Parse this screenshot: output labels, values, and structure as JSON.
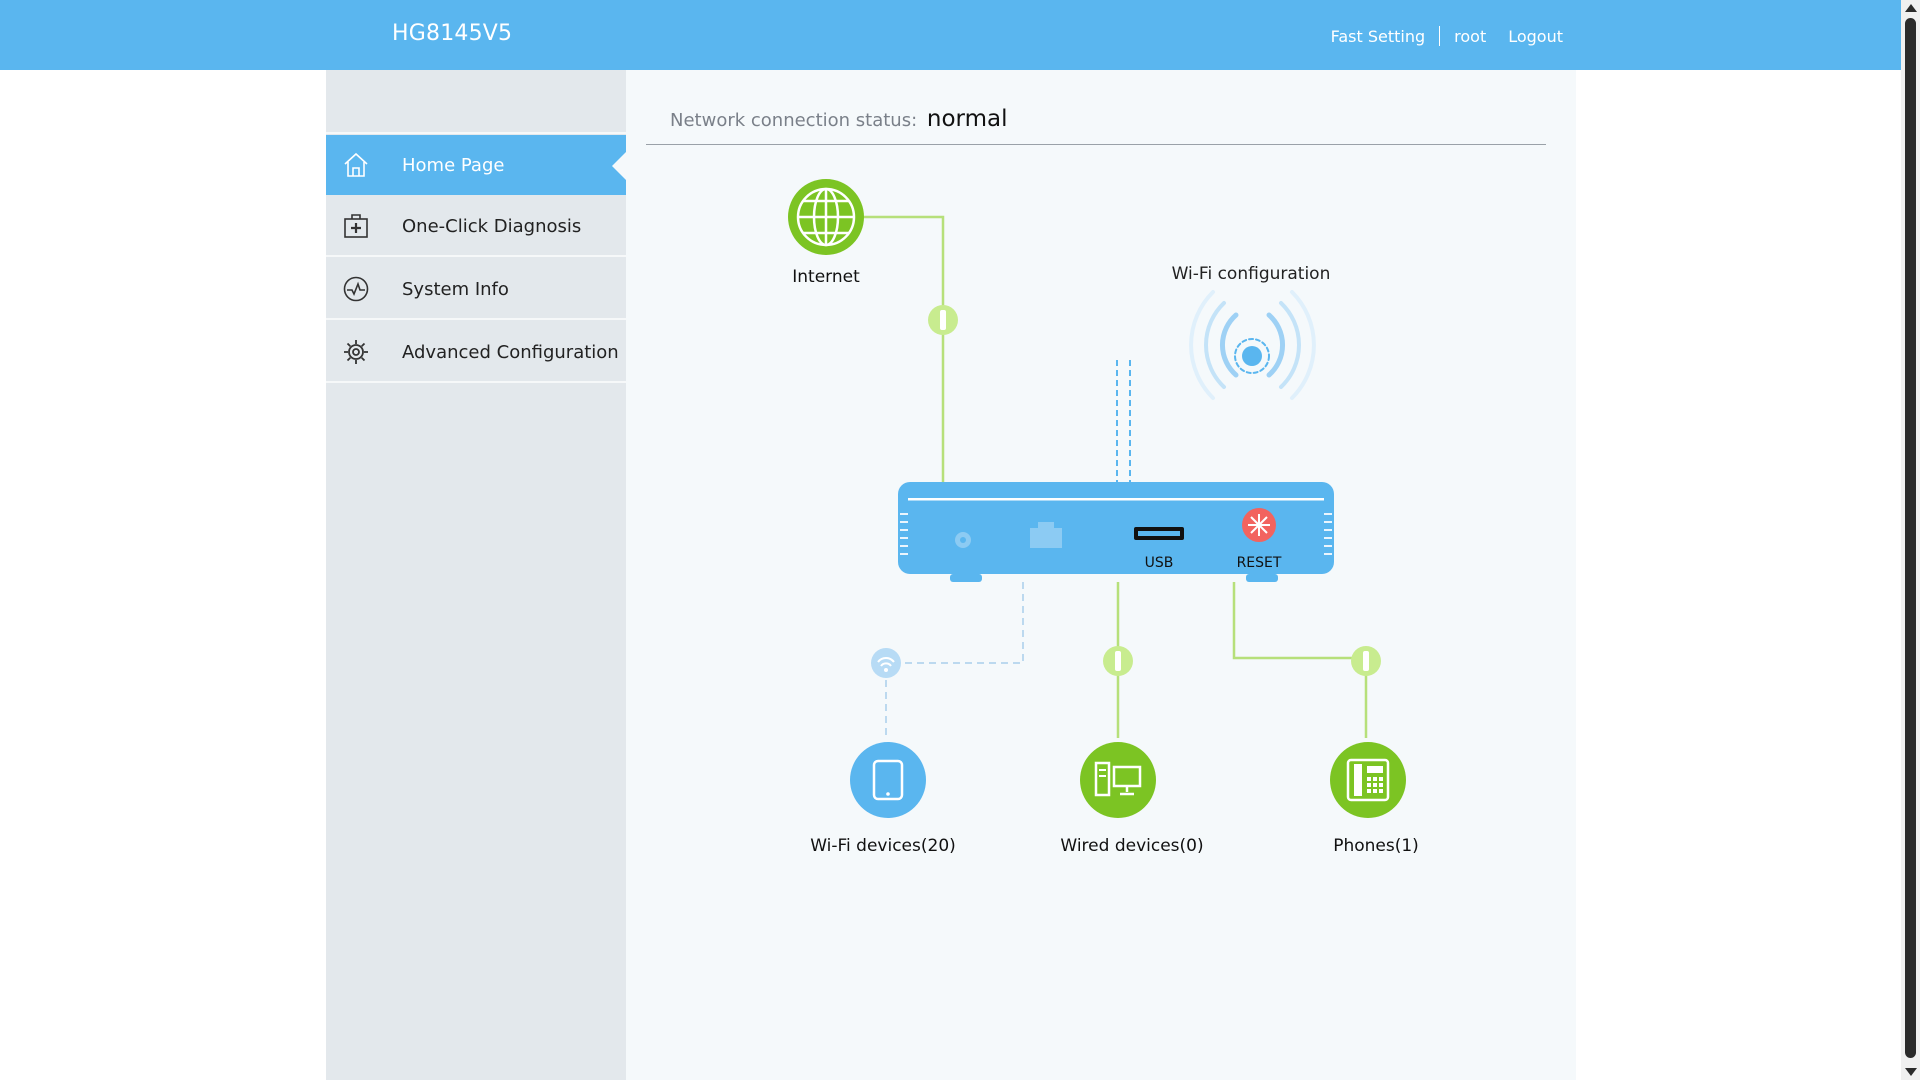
{
  "header": {
    "title": "HG8145V5",
    "links": {
      "fast_setting": "Fast Setting",
      "user": "root",
      "logout": "Logout"
    }
  },
  "sidebar": {
    "items": [
      {
        "label": "Home Page",
        "icon": "home-icon",
        "active": true
      },
      {
        "label": "One-Click Diagnosis",
        "icon": "first-aid-kit-icon",
        "active": false
      },
      {
        "label": "System Info",
        "icon": "pulse-icon",
        "active": false
      },
      {
        "label": "Advanced Configuration",
        "icon": "gear-icon",
        "active": false
      }
    ]
  },
  "main": {
    "status_label": "Network connection status:",
    "status_value": "normal",
    "diagram": {
      "internet_label": "Internet",
      "wifi_config_label": "Wi-Fi configuration",
      "usb_label": "USB",
      "reset_label": "RESET",
      "wifi_devices_label": "Wi-Fi devices(20)",
      "wired_devices_label": "Wired devices(0)",
      "phones_label": "Phones(1)"
    }
  },
  "colors": {
    "accent": "#5ab6ef",
    "green": "#7cc423",
    "reset_red": "#f2635f",
    "line_green": "#b6e07a"
  }
}
